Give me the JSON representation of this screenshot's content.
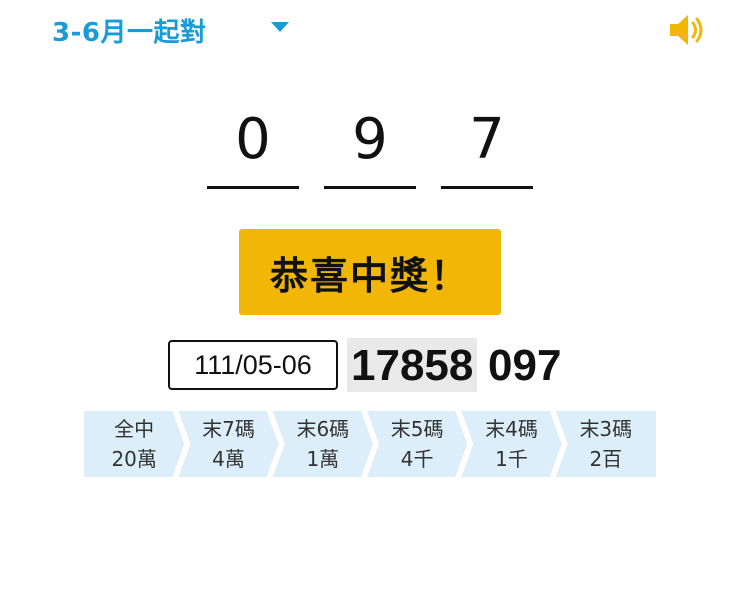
{
  "header": {
    "title": "3-6月一起對",
    "dropdown_icon": "caret-down-icon",
    "sound_icon": "speaker-icon"
  },
  "input_digits": [
    "0",
    "9",
    "7"
  ],
  "result_banner": "恭喜中獎！",
  "winning": {
    "period": "111/05-06",
    "number_prefix": "17858",
    "number_suffix": "097"
  },
  "prize_tiers": [
    {
      "label": "全中",
      "amount": "20萬"
    },
    {
      "label": "末7碼",
      "amount": "4萬"
    },
    {
      "label": "末6碼",
      "amount": "1萬"
    },
    {
      "label": "末5碼",
      "amount": "4千"
    },
    {
      "label": "末4碼",
      "amount": "1千"
    },
    {
      "label": "末3碼",
      "amount": "2百"
    }
  ],
  "colors": {
    "accent": "#1a9ad6",
    "banner": "#f2b706",
    "speaker": "#f2b706",
    "tier_bg": "#dbeef9"
  }
}
